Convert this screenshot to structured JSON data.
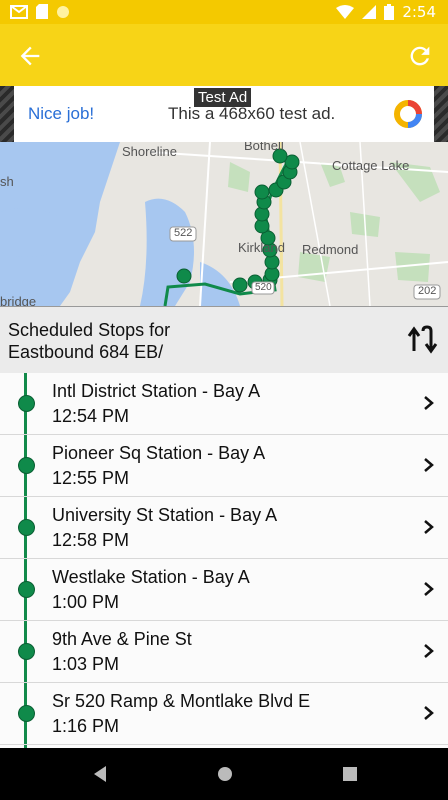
{
  "status_bar": {
    "time": "2:54"
  },
  "ad": {
    "label": "Test Ad",
    "headline": "Nice job!",
    "description": "This a 468x60 test ad."
  },
  "map": {
    "labels": [
      "Shoreline",
      "Bothell",
      "Cottage Lake",
      "Kirkland",
      "Redmond",
      "sh",
      "bridge",
      "522",
      "520",
      "202"
    ]
  },
  "schedule": {
    "title_line1": "Scheduled Stops for",
    "title_line2": "Eastbound 684 EB/"
  },
  "stops": [
    {
      "name": "Intl District Station - Bay A",
      "time": "12:54 PM"
    },
    {
      "name": "Pioneer Sq Station - Bay A",
      "time": "12:55 PM"
    },
    {
      "name": "University St Station - Bay A",
      "time": "12:58 PM"
    },
    {
      "name": "Westlake Station - Bay A",
      "time": "1:00 PM"
    },
    {
      "name": "9th Ave & Pine St",
      "time": "1:03 PM"
    },
    {
      "name": "Sr 520 Ramp & Montlake Blvd E",
      "time": "1:16 PM"
    }
  ],
  "colors": {
    "app_bar": "#f7d417",
    "route": "#0f8a4a",
    "ad_link": "#2a6fd6"
  }
}
